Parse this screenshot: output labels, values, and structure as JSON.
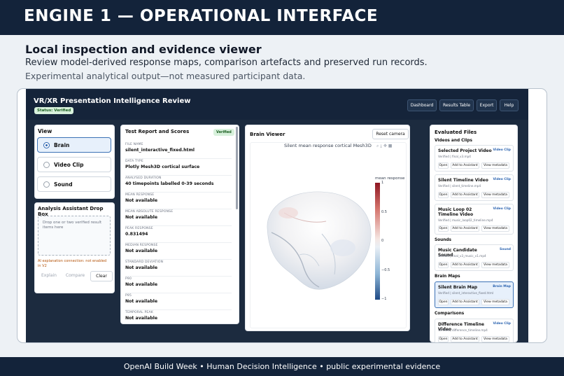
{
  "banner": {
    "title": "ENGINE 1 — OPERATIONAL INTERFACE"
  },
  "intro": {
    "title": "Local inspection and evidence viewer",
    "subtitle": "Review model-derived response maps, comparison artefacts and preserved run records.",
    "note": "Experimental analytical output—not measured participant data."
  },
  "app": {
    "title": "VR/XR Presentation Intelligence Review",
    "status": "Status: Verified",
    "nav": [
      "Dashboard",
      "Results Table",
      "Export",
      "Help"
    ]
  },
  "view_panel": {
    "heading": "View",
    "options": [
      {
        "label": "Brain",
        "selected": true
      },
      {
        "label": "Video Clip",
        "selected": false
      },
      {
        "label": "Sound",
        "selected": false
      }
    ]
  },
  "drop_panel": {
    "heading": "Analysis Assistant Drop Box",
    "placeholder": "Drop one or two verified result items here",
    "ai_note": "AI explanation connection: not enabled in V2",
    "buttons": [
      "Explain",
      "Compare",
      "Clear"
    ]
  },
  "report": {
    "heading": "Test Report and Scores",
    "badge": "Verified",
    "metrics": [
      {
        "label": "FILE NAME",
        "value": "silent_interactive_fixed.html"
      },
      {
        "label": "DATA TYPE",
        "value": "Plotly Mesh3D cortical surface"
      },
      {
        "label": "ANALYSED DURATION",
        "value": "40 timepoints labelled 0-39 seconds"
      },
      {
        "label": "MEAN RESPONSE",
        "value": "Not available"
      },
      {
        "label": "MEAN ABSOLUTE RESPONSE",
        "value": "Not available"
      },
      {
        "label": "PEAK RESPONSE",
        "value": "0.831494"
      },
      {
        "label": "MEDIAN RESPONSE",
        "value": "Not available"
      },
      {
        "label": "STANDARD DEVIATION",
        "value": "Not available"
      },
      {
        "label": "P90",
        "value": "Not available"
      },
      {
        "label": "P95",
        "value": "Not available"
      },
      {
        "label": "TEMPORAL PEAK",
        "value": "Not available"
      }
    ]
  },
  "viewer": {
    "heading": "Brain Viewer",
    "reset_label": "Reset camera",
    "plot_title": "Silent mean response cortical Mesh3D",
    "colorbar_title": "mean response",
    "ticks": [
      {
        "label": "1",
        "value": 1
      },
      {
        "label": "0.5",
        "value": 0.5
      },
      {
        "label": "0",
        "value": 0
      },
      {
        "label": "−0.5",
        "value": -0.5
      },
      {
        "label": "−1",
        "value": -1
      }
    ],
    "colors": {
      "positive": "#8e1722",
      "neutral": "#f2f2f2",
      "negative": "#1e4a85"
    }
  },
  "files": {
    "heading": "Evaluated Files",
    "buttons": {
      "open": "Open",
      "add": "Add to Assistant",
      "meta": "View metadata"
    },
    "sections": [
      {
        "label": "Videos and Clips",
        "items": [
          {
            "name": "Selected Project Video",
            "tag": "Video Clip",
            "meta": "Verified | final_v3.mp4",
            "selected": false
          },
          {
            "name": "Silent Timeline Video",
            "tag": "Video Clip",
            "meta": "Verified | silent_timeline.mp4",
            "selected": false
          },
          {
            "name": "Music Loop 02 Timeline Video",
            "tag": "Video Clip",
            "meta": "Verified | music_loop02_timeline.mp4",
            "selected": false
          }
        ]
      },
      {
        "label": "Sounds",
        "items": [
          {
            "name": "Music Candidate Sound",
            "tag": "Sound",
            "meta": "Verified | final_v3_music_v1.mp4",
            "selected": false
          }
        ]
      },
      {
        "label": "Brain Maps",
        "items": [
          {
            "name": "Silent Brain Map",
            "tag": "Brain Map",
            "meta": "Verified | silent_interactive_fixed.html",
            "selected": true
          }
        ]
      },
      {
        "label": "Comparisons",
        "items": [
          {
            "name": "Difference Timeline Video",
            "tag": "Video Clip",
            "meta": "Verified | difference_timeline.mp4",
            "selected": false
          }
        ]
      }
    ]
  },
  "footer": {
    "text": "OpenAI Build Week • Human Decision Intelligence • public experimental evidence"
  }
}
